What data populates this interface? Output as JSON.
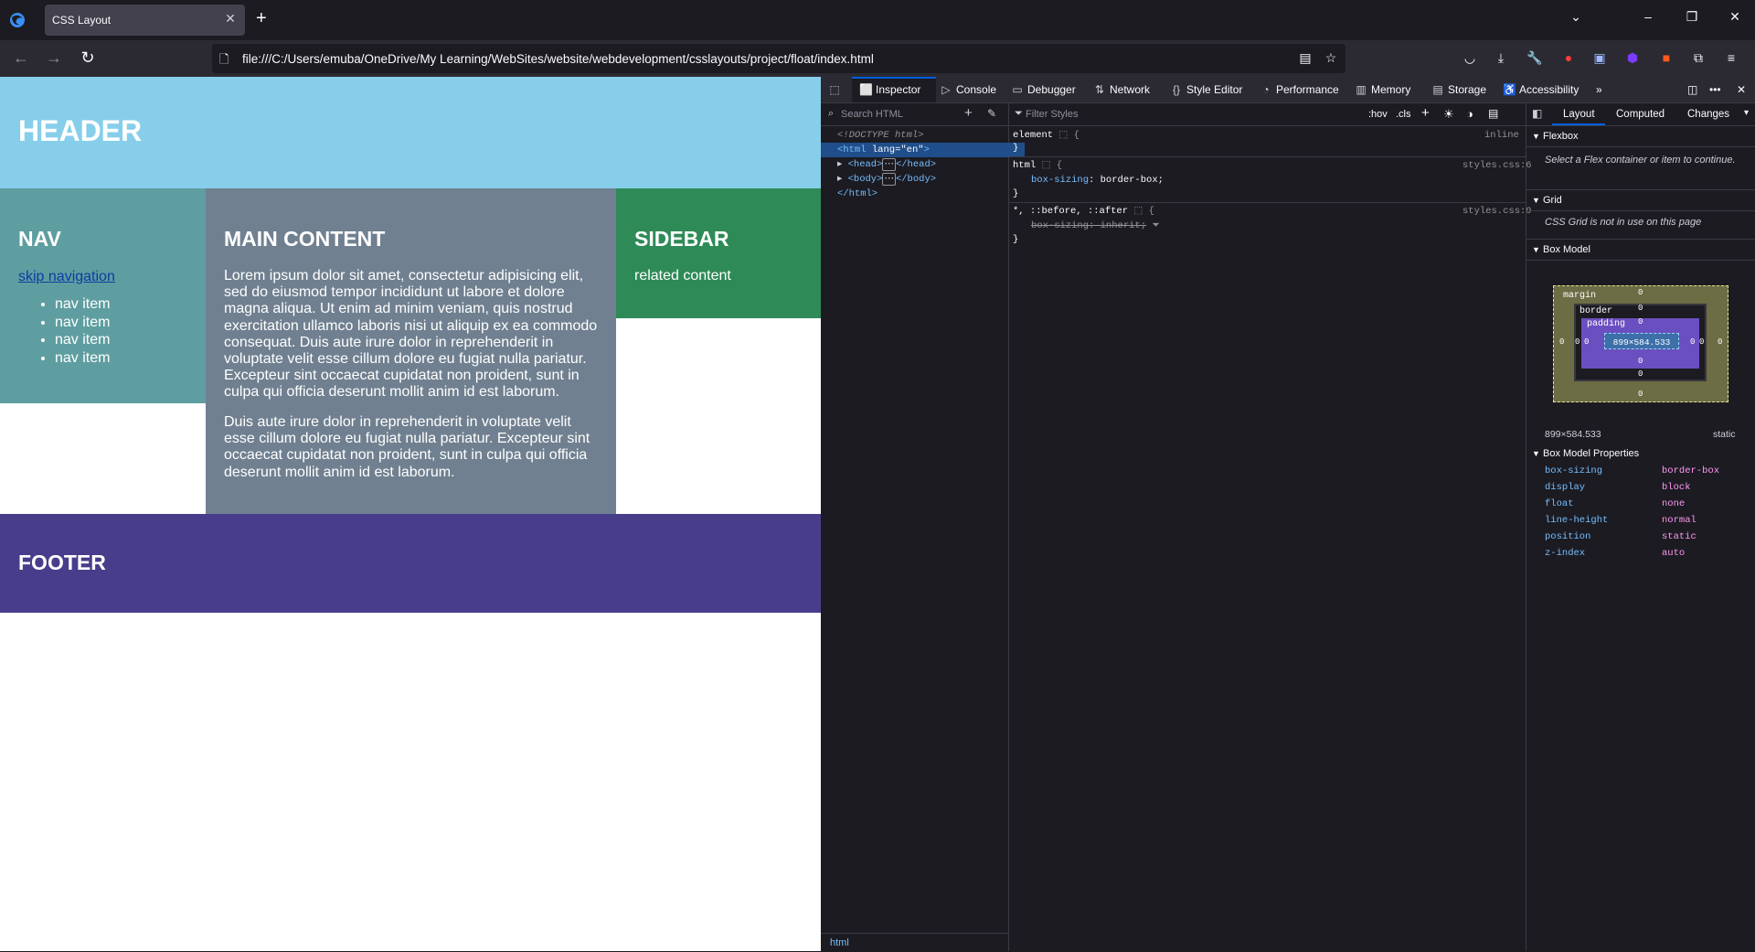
{
  "browser": {
    "tab_title": "CSS Layout",
    "url": "file:///C:/Users/emuba/OneDrive/My Learning/WebSites/website/webdevelopment/csslayouts/project/float/index.html"
  },
  "page": {
    "header": "HEADER",
    "nav_title": "NAV",
    "skip_link": "skip navigation",
    "nav_items": [
      "nav item",
      "nav item",
      "nav item",
      "nav item"
    ],
    "main_title": "MAIN CONTENT",
    "main_p1": "Lorem ipsum dolor sit amet, consectetur adipisicing elit, sed do eiusmod tempor incididunt ut labore et dolore magna aliqua. Ut enim ad minim veniam, quis nostrud exercitation ullamco laboris nisi ut aliquip ex ea commodo consequat. Duis aute irure dolor in reprehenderit in voluptate velit esse cillum dolore eu fugiat nulla pariatur. Excepteur sint occaecat cupidatat non proident, sunt in culpa qui officia deserunt mollit anim id est laborum.",
    "main_p2": "Duis aute irure dolor in reprehenderit in voluptate velit esse cillum dolore eu fugiat nulla pariatur. Excepteur sint occaecat cupidatat non proident, sunt in culpa qui officia deserunt mollit anim id est laborum.",
    "sidebar_title": "SIDEBAR",
    "sidebar_text": "related content",
    "footer": "FOOTER"
  },
  "devtools": {
    "tabs": [
      "Inspector",
      "Console",
      "Debugger",
      "Network",
      "Style Editor",
      "Performance",
      "Memory",
      "Storage",
      "Accessibility"
    ],
    "search_placeholder": "Search HTML",
    "markup": {
      "doctype": "<!DOCTYPE html>",
      "html_open_tag": "html",
      "html_attr": "lang",
      "html_attr_val": "\"en\"",
      "head": "head",
      "body": "body",
      "html_close": "</html>"
    },
    "breadcrumb": "html",
    "filter_placeholder": "Filter Styles",
    "hov": ":hov",
    "cls": ".cls",
    "rules": {
      "r1_sel": "element",
      "r1_src": "inline",
      "r2_sel": "html",
      "r2_src": "styles.css:6",
      "r2_prop": "box-sizing",
      "r2_val": "border-box;",
      "r3_sel": "*, ::before, ::after",
      "r3_src": "styles.css:9",
      "r3_text": "box-sizing: inherit;"
    },
    "side_tabs": [
      "Layout",
      "Computed",
      "Changes"
    ],
    "flexbox_title": "Flexbox",
    "flexbox_note": "Select a Flex container or item to continue.",
    "grid_title": "Grid",
    "grid_note": "CSS Grid is not in use on this page",
    "box_model_title": "Box Model",
    "bm_labels": {
      "margin": "margin",
      "border": "border",
      "padding": "padding"
    },
    "bm_zero": "0",
    "content_size": "899×584.533",
    "position_label": "static",
    "bmp_title": "Box Model Properties",
    "box_props": [
      {
        "name": "box-sizing",
        "value": "border-box"
      },
      {
        "name": "display",
        "value": "block"
      },
      {
        "name": "float",
        "value": "none"
      },
      {
        "name": "line-height",
        "value": "normal"
      },
      {
        "name": "position",
        "value": "static"
      },
      {
        "name": "z-index",
        "value": "auto"
      }
    ]
  },
  "colors": {
    "header": "#87ceeb",
    "nav": "#5f9ea0",
    "main": "#708090",
    "sidebar": "#2e8b57",
    "footer": "#483d8b",
    "accent": "#0060df"
  }
}
